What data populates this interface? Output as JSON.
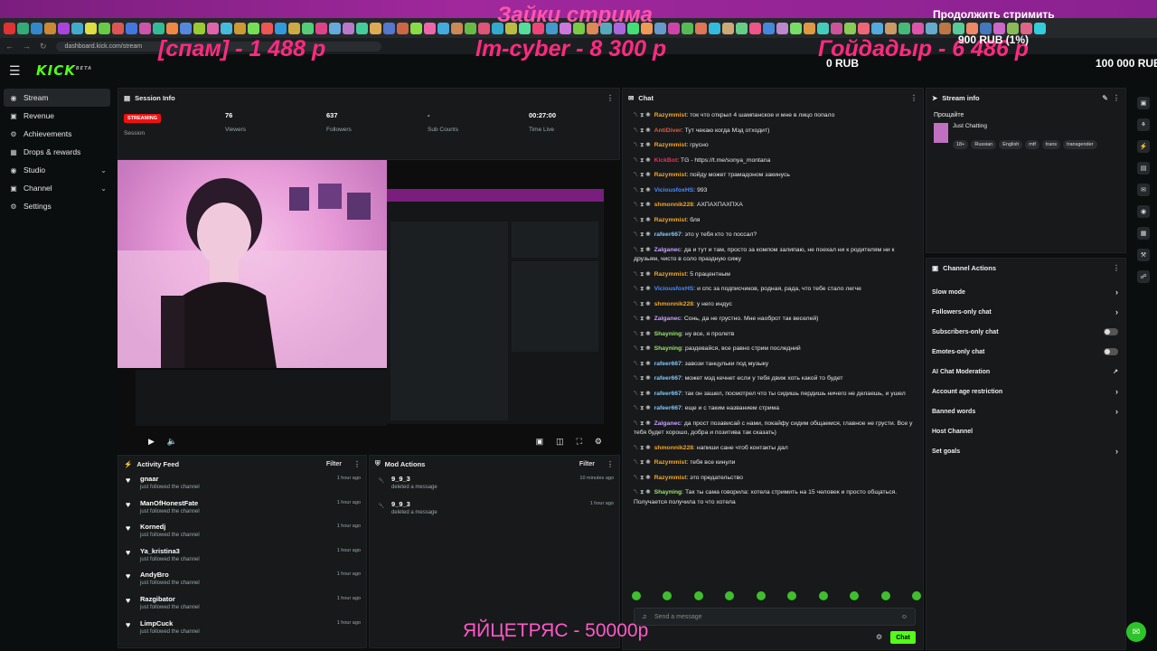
{
  "browser": {
    "url": "dashboard.kick.com/stream",
    "tab_colors": [
      "#d33",
      "#3a7",
      "#38c",
      "#c83",
      "#a4d",
      "#4ac",
      "#dd4",
      "#6c4",
      "#d55",
      "#47d",
      "#c5a",
      "#3b9",
      "#e84",
      "#58d",
      "#9c3",
      "#d6a",
      "#4bd",
      "#c93",
      "#7d5",
      "#e55",
      "#39d",
      "#ca4",
      "#5c7",
      "#d48",
      "#6ad",
      "#b7c",
      "#4c9",
      "#da5",
      "#57c",
      "#c64",
      "#8d4",
      "#e6a",
      "#4ad",
      "#c85",
      "#6b4",
      "#d57",
      "#3ac",
      "#bb4",
      "#5d9",
      "#e47",
      "#49c",
      "#c7d",
      "#7c4",
      "#d85",
      "#5ab",
      "#a6d",
      "#4d7",
      "#e95",
      "#69c",
      "#c4a",
      "#5b5",
      "#d75",
      "#3bd",
      "#ca7",
      "#6c8",
      "#e58",
      "#48d",
      "#b8c",
      "#7d6",
      "#d94",
      "#4cb",
      "#c59",
      "#8c5",
      "#e67",
      "#5ad",
      "#c96",
      "#4b7",
      "#d5a",
      "#6ac",
      "#b74",
      "#5c9",
      "#e86",
      "#47b",
      "#c6c",
      "#8b5",
      "#d68",
      "#3cd"
    ]
  },
  "overlay": {
    "top_title": "Зайки стрима",
    "spam": "[спам] - 1 488 р",
    "lm_cyber": "lm-cyber - 8 300 р",
    "goy": "Гойдадыр - 6 486 р",
    "continue": "Продолжить стримить",
    "rub900": "900 RUB (1%)",
    "rub0": "0 RUB",
    "rub100k": "100 000 RUB",
    "bottom": "ЯЙЦЕТРЯС - 50000р"
  },
  "header": {
    "logo": "KICK",
    "logo_sup": "BETA"
  },
  "sidebar": {
    "items": [
      {
        "label": "Stream",
        "icon": "stream-icon"
      },
      {
        "label": "Revenue",
        "icon": "revenue-icon"
      },
      {
        "label": "Achievements",
        "icon": "achievements-icon"
      },
      {
        "label": "Drops & rewards",
        "icon": "drops-icon"
      },
      {
        "label": "Studio",
        "icon": "studio-icon"
      },
      {
        "label": "Channel",
        "icon": "channel-icon"
      },
      {
        "label": "Settings",
        "icon": "settings-icon"
      }
    ]
  },
  "session": {
    "title": "Session Info",
    "badge": "STREAMING",
    "session_label": "Session",
    "viewers_value": "76",
    "viewers_label": "Viewers",
    "followers_value": "637",
    "followers_label": "Followers",
    "subs_value": "-",
    "subs_label": "Sub Counts",
    "time_value": "00:27:00",
    "time_label": "Time Live"
  },
  "video": {
    "caption": "ЯЙЦЕТРЯС - 50000р"
  },
  "activity": {
    "title": "Activity Feed",
    "filter": "Filter",
    "rows": [
      {
        "name": "gnaar",
        "desc": "just followed the channel",
        "time": "1 hour ago"
      },
      {
        "name": "ManOfHonestFate",
        "desc": "just followed the channel",
        "time": "1 hour ago"
      },
      {
        "name": "Kornedj",
        "desc": "just followed the channel",
        "time": "1 hour ago"
      },
      {
        "name": "Ya_kristina3",
        "desc": "just followed the channel",
        "time": "1 hour ago"
      },
      {
        "name": "AndyBro",
        "desc": "just followed the channel",
        "time": "1 hour ago"
      },
      {
        "name": "Razgibator",
        "desc": "just followed the channel",
        "time": "1 hour ago"
      },
      {
        "name": "LimpCuck",
        "desc": "just followed the channel",
        "time": "1 hour ago"
      }
    ]
  },
  "mod": {
    "title": "Mod Actions",
    "filter": "Filter",
    "rows": [
      {
        "name": "9_9_3",
        "desc": "deleted a message",
        "time": "10 minutes ago"
      },
      {
        "name": "9_9_3",
        "desc": "deleted a message",
        "time": "1 hour ago"
      }
    ]
  },
  "chat": {
    "title": "Chat",
    "placeholder": "Send a message",
    "send": "Chat",
    "messages": [
      {
        "user": "Razymmist",
        "color": "#f5a623",
        "text": "ток что открыл 4 шампанское и мне в лицо попало"
      },
      {
        "user": "AntiDiver",
        "color": "#e35b3a",
        "text": "Тут чекаю когда Мэд отходит)"
      },
      {
        "user": "Razymmist",
        "color": "#f5a623",
        "text": "грусно"
      },
      {
        "user": "KickBot",
        "color": "#e7345a",
        "text": "TG - https://t.me/sonya_montana"
      },
      {
        "user": "Razymmist",
        "color": "#f5a623",
        "text": "пойду может трамадоном закинусь"
      },
      {
        "user": "ViciousfoxHS",
        "color": "#4a8cff",
        "text": "993"
      },
      {
        "user": "shmonnik228",
        "color": "#f5a623",
        "text": "АХПАХПАХПХА"
      },
      {
        "user": "Razymmist",
        "color": "#f5a623",
        "text": "бля"
      },
      {
        "user": "rafeer667",
        "color": "#7ec8ff",
        "text": "это у тебя кто то поссал?"
      },
      {
        "user": "Zalganec",
        "color": "#c8a2ff",
        "text": "да и тут и там, просто за компом залипаю, не поехал ни к родителям ни к друзьям, чисто в соло праздную сижу"
      },
      {
        "user": "Razymmist",
        "color": "#f5a623",
        "text": "5 працентным"
      },
      {
        "user": "ViciousfoxHS",
        "color": "#4a8cff",
        "text": "и спс за подписчиков, родная, рада, что тебе стало легче"
      },
      {
        "user": "shmonnik228",
        "color": "#f5a623",
        "text": "у него индус"
      },
      {
        "user": "Zalganec",
        "color": "#c8a2ff",
        "text": "Сонь, да не грустно. Мне наоброт так веселей)"
      },
      {
        "user": "Shayning",
        "color": "#9be56a",
        "text": "ну все, я пролетв"
      },
      {
        "user": "Shayning",
        "color": "#9be56a",
        "text": "раздевайся, все равно стрим последний"
      },
      {
        "user": "rafeer667",
        "color": "#7ec8ff",
        "text": "завози танцульки под музыку"
      },
      {
        "user": "rafeer667",
        "color": "#7ec8ff",
        "text": "может мэд кечнет если у тебя движ хоть какой то будет"
      },
      {
        "user": "rafeer667",
        "color": "#7ec8ff",
        "text": "так он зашел, посмотрел что ты сидишь пердишь ничего не делаешь, и ушел"
      },
      {
        "user": "rafeer667",
        "color": "#7ec8ff",
        "text": "еще и с таким названием стрима"
      },
      {
        "user": "Zalganec",
        "color": "#c8a2ff",
        "text": "да прост позависай с нами, покайфу сидим общаемся, главное не грусти. Все у тебя будет хорошо, добра и позитива так сказать)"
      },
      {
        "user": "shmonnik228",
        "color": "#f5a623",
        "text": "напиши сане чтоб контакты дал"
      },
      {
        "user": "Razymmist",
        "color": "#f5a623",
        "text": "тебя все кинули"
      },
      {
        "user": "Razymmist",
        "color": "#f5a623",
        "text": "это предательство"
      },
      {
        "user": "Shayning",
        "color": "#9be56a",
        "text": "Так ты сама говорила: хотела стримить на 15 человек и просто общаться. Получается получила то что хотела"
      }
    ]
  },
  "streaminfo": {
    "title": "Stream info",
    "stream_title": "Прощайте",
    "category": "Just Chatting",
    "tags": [
      "18+",
      "Russian",
      "English",
      "mtf",
      "trans",
      "transgender"
    ]
  },
  "channel_actions": {
    "title": "Channel Actions",
    "items": [
      {
        "label": "Slow mode",
        "kind": "arrow"
      },
      {
        "label": "Followers-only chat",
        "kind": "arrow"
      },
      {
        "label": "Subscribers-only chat",
        "kind": "toggle"
      },
      {
        "label": "Emotes-only chat",
        "kind": "toggle"
      },
      {
        "label": "AI Chat Moderation",
        "kind": "external"
      },
      {
        "label": "Account age restriction",
        "kind": "arrow"
      },
      {
        "label": "Banned words",
        "kind": "arrow"
      },
      {
        "label": "Host Channel",
        "kind": "none"
      },
      {
        "label": "Set goals",
        "kind": "arrow"
      }
    ]
  },
  "colors": {
    "accent": "#53fc18",
    "live": "#ee1111"
  }
}
